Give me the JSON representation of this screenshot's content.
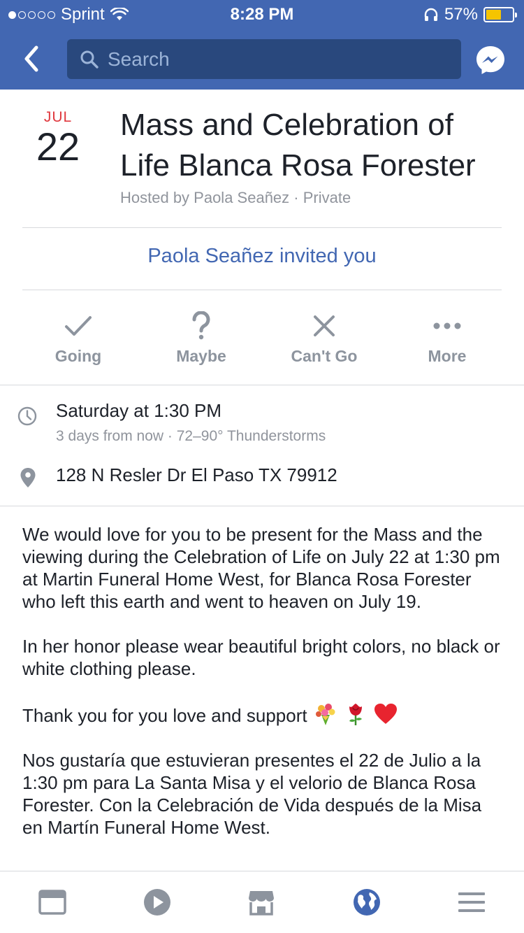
{
  "status_bar": {
    "carrier": "Sprint",
    "time": "8:28 PM",
    "battery_percent": "57%",
    "battery_level": 0.57,
    "signal_bars_filled": 1,
    "signal_bars_total": 5
  },
  "nav": {
    "search_placeholder": "Search",
    "icons": [
      "back-chevron-icon",
      "search-icon",
      "messenger-icon"
    ]
  },
  "event": {
    "month": "JUL",
    "day": "22",
    "title": "Mass and Celebration of Life Blanca Rosa Forester",
    "host_line": "Hosted by Paola Seañez · Private",
    "invite_text": "Paola Seañez invited you"
  },
  "actions": [
    {
      "label": "Going",
      "icon": "check-icon"
    },
    {
      "label": "Maybe",
      "icon": "question-icon"
    },
    {
      "label": "Can't Go",
      "icon": "x-icon"
    },
    {
      "label": "More",
      "icon": "more-dots-icon"
    }
  ],
  "details": {
    "time_main": "Saturday at 1:30 PM",
    "time_sub": "3 days from now · 72–90° Thunderstorms",
    "location": "128 N Resler Dr El Paso TX 79912"
  },
  "description": {
    "p1": "We would love for you to be present for the Mass and the viewing during the Celebration of Life on July 22 at 1:30 pm at Martin Funeral Home West, for Blanca Rosa Forester who left this earth and went to heaven on July 19.",
    "p2": "In her honor please wear beautiful bright colors, no black or white clothing please.",
    "p3": "Thank you for you love and support",
    "p4": "Nos gustaría que estuvieran presentes el 22 de Julio a la 1:30 pm para La Santa Misa y el velorio de Blanca Rosa Forester. Con la Celebración de Vida después de la Misa en Martín Funeral Home West."
  },
  "tabbar": {
    "tabs": [
      "news-feed-icon",
      "video-icon",
      "marketplace-icon",
      "notifications-globe-icon",
      "menu-icon"
    ],
    "active_tab": "notifications-globe-icon"
  },
  "colors": {
    "brand_blue": "#4267b2",
    "search_bg": "#29487d",
    "date_red": "#e0393e",
    "muted_gray": "#90949c"
  }
}
